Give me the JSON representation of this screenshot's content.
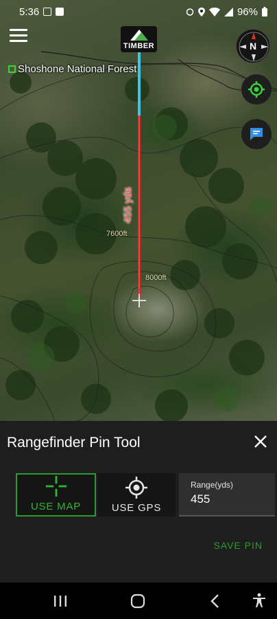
{
  "status_bar": {
    "time": "5:36",
    "battery": "96%"
  },
  "map": {
    "logo_text": "TIMBER",
    "compass_label": "N",
    "forest_label": "Shoshone National Forest",
    "range_line_label": "455 yds",
    "elevation_labels": [
      "7600ft",
      "8000ft"
    ]
  },
  "panel": {
    "title": "Rangefinder Pin Tool",
    "use_map_label": "USE MAP",
    "use_gps_label": "USE GPS",
    "range_field_label": "Range(yds)",
    "range_value": "455",
    "save_pin_label": "SAVE PIN"
  },
  "colors": {
    "accent_green": "#2e9a2e",
    "range_line_red": "#d42020",
    "range_line_blue": "#3ec6e8",
    "panel_background": "#1e1e1e"
  },
  "icons": [
    "menu-icon",
    "compass-icon",
    "locate-icon",
    "chat-icon",
    "close-icon",
    "crosshair-icon",
    "gps-target-icon",
    "recents-icon",
    "home-icon",
    "back-icon",
    "accessibility-icon"
  ]
}
